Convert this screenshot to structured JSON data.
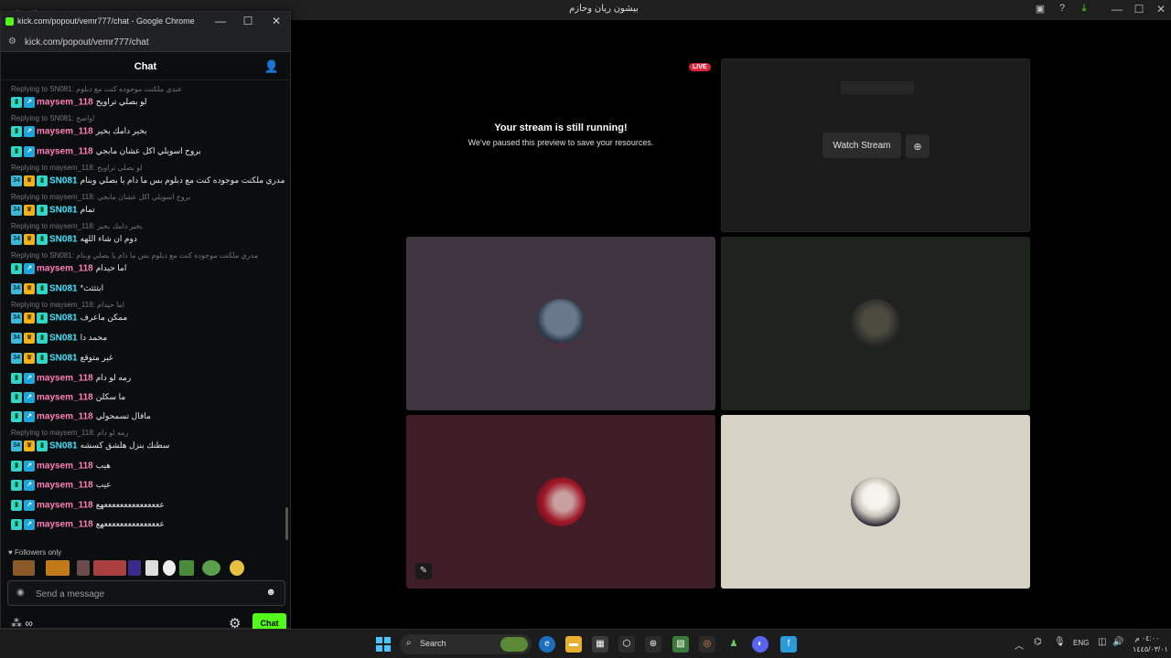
{
  "main_window": {
    "title": "بيشون ريان وحازم",
    "controls": [
      "—",
      "☐",
      "✕"
    ]
  },
  "popout": {
    "title": "kick.com/popout/vemr777/chat - Google Chrome",
    "url": "kick.com/popout/vemr777/chat",
    "chat_title": "Chat"
  },
  "messages": [
    {
      "reply": "Replying to SN081: عندي ملكنت موجوده كنت مع دبلوم",
      "user": "maysem_118",
      "text": "لو بصلي تراويح"
    },
    {
      "reply": "Replying to SN081: واضح!",
      "user": "maysem_118",
      "text": "بخير دامك بخير"
    },
    {
      "reply": "",
      "user": "maysem_118",
      "text": "بروح اسويلي اكل عشان مابجي"
    },
    {
      "reply": "Replying to maysem_118: لو بصلي تراويح",
      "user": "SN081",
      "text": "مدري ملكنت موجوده كنت مع دبلوم بس ما دام يا بصلي وبنام"
    },
    {
      "reply": "Replying to maysem_118: بروح اسويلي اكل عشان مابجي",
      "user": "SN081",
      "text": "تمام"
    },
    {
      "reply": "Replying to maysem_118: بخير دامك بخير",
      "user": "SN081",
      "text": "دوم ان شاء اللهه"
    },
    {
      "reply": "Replying to SN081: مدري ملكنت موجوده كنت مع دبلوم بس ما دام يا بصلي وبنام",
      "user": "maysem_118",
      "text": "اما حيدام"
    },
    {
      "reply": "",
      "user": "SN081",
      "text": "*ابثثثث"
    },
    {
      "reply": "Replying to maysem_118: اما حيدام",
      "user": "SN081",
      "text": "ممكن ماعرف"
    },
    {
      "reply": "",
      "user": "SN081",
      "text": "محمد دا"
    },
    {
      "reply": "",
      "user": "SN081",
      "text": "غير متوقع"
    },
    {
      "reply": "",
      "user": "maysem_118",
      "text": "رمه لو دام"
    },
    {
      "reply": "",
      "user": "maysem_118",
      "text": "ما سكلن"
    },
    {
      "reply": "",
      "user": "maysem_118",
      "text": "مافال تسمحولي"
    },
    {
      "reply": "Replying to maysem_118: رمه لو دام",
      "user": "SN081",
      "text": "سطنك بنزل هلشق كسشه"
    },
    {
      "reply": "",
      "user": "maysem_118",
      "text": "هيب"
    },
    {
      "reply": "",
      "user": "maysem_118",
      "text": "عيب"
    },
    {
      "reply": "",
      "user": "maysem_118",
      "text": "عععععععععععععععهع"
    },
    {
      "reply": "",
      "user": "maysem_118",
      "text": "عععععععععععععععهع"
    }
  ],
  "followers_only": "Followers only",
  "input": {
    "placeholder": "Send a message"
  },
  "chat_button": "Chat",
  "bottom_left": "∞",
  "stream": {
    "live": "LIVE",
    "paused_title": "Your stream is still running!",
    "paused_sub": "We've paused this preview to save your resources.",
    "watch_button": "Watch Stream"
  },
  "taskbar": {
    "search": "Search",
    "lang": "ENG",
    "time": "٠٤:٠٠ م",
    "date": "١٤٤٥/٠٣/٠١"
  },
  "colors": {
    "kick_green": "#53fc18",
    "maysem_name": "#ff7eb6",
    "sn_name": "#40e4ff",
    "live_red": "#e0243e"
  }
}
